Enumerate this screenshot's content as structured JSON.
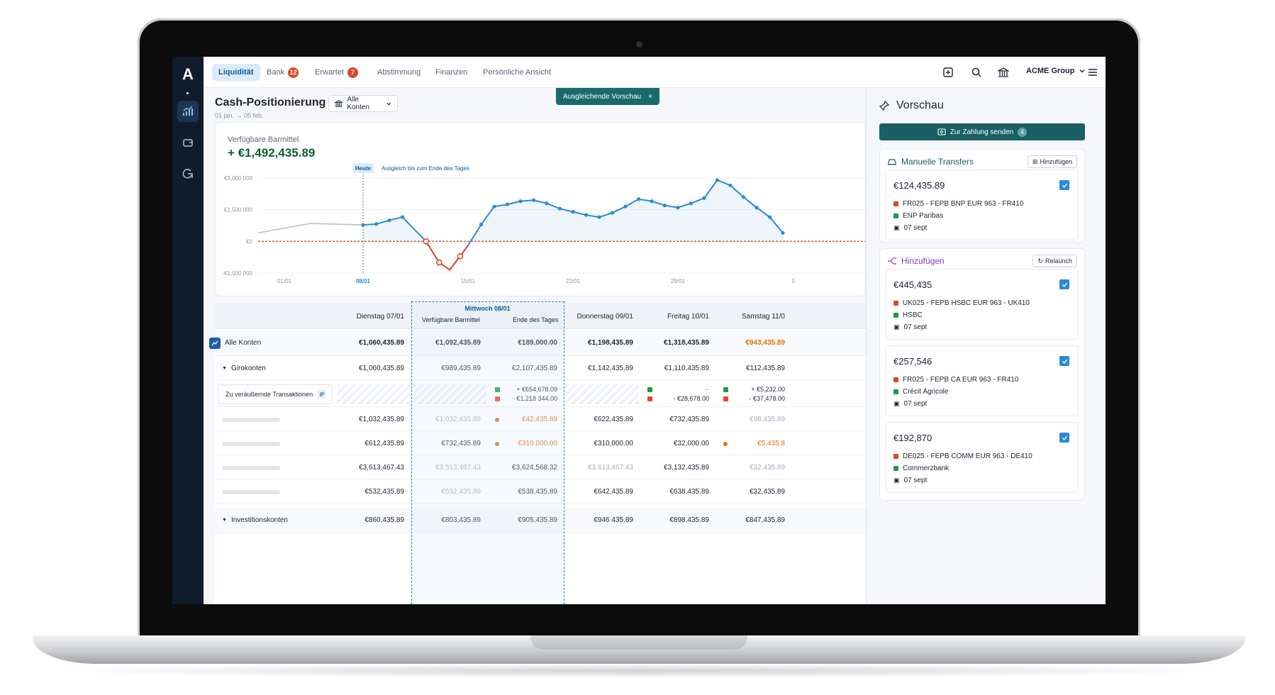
{
  "sidebar": {
    "logo": "A"
  },
  "topbar": {
    "tabs": [
      {
        "label": "Liquidität"
      },
      {
        "label": "Bank",
        "badge": "12"
      },
      {
        "label": "Erwartet",
        "badge": "7"
      },
      {
        "label": "Abstimmung"
      },
      {
        "label": "Finanzen"
      },
      {
        "label": "Persönliche Ansicht"
      }
    ],
    "org": "ACME Group"
  },
  "page": {
    "title": "Cash-Positionierung",
    "dates": "01 jan. → 05 feb.",
    "account_filter": "Alle Konten",
    "toast": "Ausgleichende Vorschau",
    "toast_close": "×"
  },
  "chart_data": {
    "type": "line",
    "title": "Verfügbare Barmittel",
    "headline_value": "+ €1,492,435.89",
    "today_label": "Heute",
    "projection_label": "Ausgleich bis zum Ende des Tages",
    "x_ticks": [
      "01/01",
      "08/01",
      "15/01",
      "22/01",
      "29/01",
      "5"
    ],
    "y_ticks": [
      "€3,000 000",
      "€1,500 000",
      "€0",
      "-€1,500 000"
    ],
    "ylim": [
      -1500000,
      3000000
    ],
    "series": [
      {
        "values": [
          [
            0,
            400000
          ],
          [
            4,
            850000
          ],
          [
            8,
            780000
          ]
        ]
      },
      {
        "values": [
          [
            8,
            780000
          ],
          [
            9,
            820000
          ],
          [
            10,
            1000000
          ],
          [
            11,
            1150000
          ],
          [
            12.8,
            0
          ],
          [
            13.8,
            -1000000
          ],
          [
            14.6,
            -1350000
          ],
          [
            15.4,
            -700000
          ],
          [
            16,
            -200000
          ],
          [
            17,
            800000
          ],
          [
            18,
            1650000
          ],
          [
            19,
            1750000
          ],
          [
            20,
            1900000
          ],
          [
            21,
            1950000
          ],
          [
            22,
            1800000
          ],
          [
            23,
            1550000
          ],
          [
            24,
            1400000
          ],
          [
            25,
            1250000
          ],
          [
            26,
            1150000
          ],
          [
            27,
            1350000
          ],
          [
            28,
            1650000
          ],
          [
            29,
            2000000
          ],
          [
            30,
            1900000
          ],
          [
            31,
            1700000
          ],
          [
            32,
            1600000
          ],
          [
            33,
            1800000
          ],
          [
            34,
            2050000
          ],
          [
            35,
            2900000
          ],
          [
            36,
            2650000
          ],
          [
            37,
            2100000
          ],
          [
            38,
            1600000
          ],
          [
            39,
            1150000
          ],
          [
            40,
            400000
          ]
        ]
      },
      {
        "values": [
          [
            12.8,
            0
          ],
          [
            13.8,
            -1000000
          ],
          [
            14.6,
            -1350000
          ],
          [
            15.4,
            -700000
          ],
          [
            16,
            -200000
          ]
        ]
      }
    ]
  },
  "table": {
    "highlight_title": "Mittwoch 08/01",
    "highlight_sub1": "Verfügbare Barmittel",
    "highlight_sub2": "Ende des Tages",
    "columns": [
      "Dienstag 07/01",
      "",
      "",
      "Donnerstag 09/01",
      "Freitag 10/01",
      "Samstag 11/0"
    ],
    "rows": {
      "all": {
        "label": "Alle Konten",
        "cells": [
          "€1,060,435.89",
          "€1,092,435.89",
          "€189,000.00",
          "€1,198,435.89",
          "€1,318,435.89",
          "€943,435.89"
        ]
      },
      "giro": {
        "label": "Girokonten",
        "cells": [
          "€1,060,435.89",
          "€989,435.89",
          "€2,107,435.89",
          "€1,142,435.89",
          "€1,110,435.89",
          "€112,435.89"
        ]
      },
      "pending": {
        "label": "Zu veräußernde Transaktionen",
        "c3a": "+ €654,678.09",
        "c3b": "- €1,218 344.00",
        "c5b": "- €28,678.00",
        "c5a": "--",
        "c6a": "+ €5,232.00",
        "c6b": "- €37,478.00"
      },
      "r1": [
        "€1,032,435.89",
        "€1,032,435.89",
        "€42,435.89",
        "€622,435.89",
        "€732,435.89",
        "€98,435.89"
      ],
      "r2": [
        "€612,435.89",
        "€732,435.89",
        "€310,000.00",
        "€310,000.00",
        "€32,000.00",
        "€5,435.8"
      ],
      "r3": [
        "€3,613,467.43",
        "€3,513,467.43",
        "€3,624,568.32",
        "€3,613,467.43",
        "€3,132,435.89",
        "€32,435.89"
      ],
      "r4": [
        "€532,435.89",
        "€532,435.89",
        "€538,435.89",
        "€642,435.89",
        "€638,435.89",
        "€32,435.89"
      ],
      "invest": {
        "label": "Investitionskonten",
        "cells": [
          "€860,435.89",
          "€803,435.89",
          "€905,435.89",
          "€946 435.89",
          "€898,435.89",
          "€847,435.89"
        ]
      }
    }
  },
  "panel": {
    "title": "Vorschau",
    "send": "Zur Zahlung senden",
    "send_count": "4",
    "manual": {
      "title": "Manuelle Transfers",
      "btn": "Hinzufügen",
      "cards": [
        {
          "amount": "€124,435.89",
          "route": "FR025 - FEPB BNP EUR 963 - FR410",
          "bank": "ENP Paribas",
          "date": "07 sept"
        }
      ]
    },
    "add": {
      "title": "Hinzufügen",
      "btn": "Relaunch",
      "cards": [
        {
          "amount": "€445,435",
          "route": "UK025 - FEPB HSBC EUR 963 - UK410",
          "bank": "HSBC",
          "date": "07 sept"
        },
        {
          "amount": "€257,546",
          "route": "FR025 - FEPB CA EUR 963 - FR410",
          "bank": "Crécit Agricole",
          "date": "07 sept"
        },
        {
          "amount": "€192,870",
          "route": "DE025 - FEPB COMM EUR 963 - DE410",
          "bank": "Commerzbank",
          "date": "07 sept"
        }
      ]
    }
  },
  "colors": {
    "accent": "#1b5f66",
    "positive": "#0c5e2c",
    "line": "#2a8ad8",
    "negative": "#e2462a",
    "orange": "#e0740c"
  }
}
